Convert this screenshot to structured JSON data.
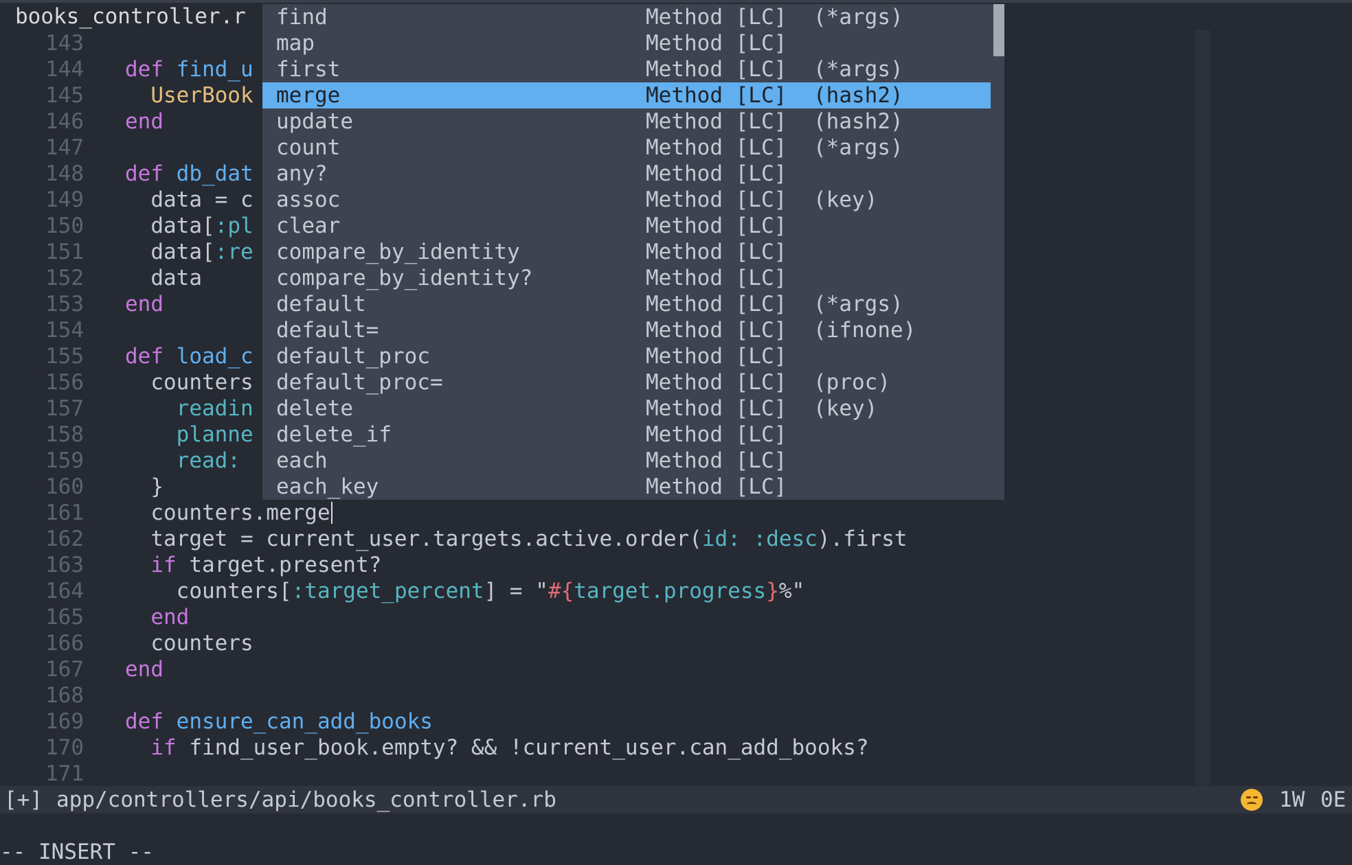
{
  "tab": {
    "title": "books_controller.r"
  },
  "code_lines": [
    {
      "num": "143",
      "tokens": []
    },
    {
      "num": "144",
      "tokens": [
        {
          "t": "keyword",
          "v": "def"
        },
        {
          "t": "text",
          "v": " "
        },
        {
          "t": "function",
          "v": "find_u"
        }
      ]
    },
    {
      "num": "145",
      "tokens": [
        {
          "t": "text",
          "v": "  "
        },
        {
          "t": "constant",
          "v": "UserBook"
        }
      ]
    },
    {
      "num": "146",
      "tokens": [
        {
          "t": "keyword",
          "v": "end"
        }
      ]
    },
    {
      "num": "147",
      "tokens": []
    },
    {
      "num": "148",
      "tokens": [
        {
          "t": "keyword",
          "v": "def"
        },
        {
          "t": "text",
          "v": " "
        },
        {
          "t": "function",
          "v": "db_dat"
        }
      ]
    },
    {
      "num": "149",
      "tokens": [
        {
          "t": "text",
          "v": "  data = c"
        }
      ]
    },
    {
      "num": "150",
      "tokens": [
        {
          "t": "text",
          "v": "  data["
        },
        {
          "t": "symbol",
          "v": ":pl"
        }
      ]
    },
    {
      "num": "151",
      "tokens": [
        {
          "t": "text",
          "v": "  data["
        },
        {
          "t": "symbol",
          "v": ":re"
        }
      ]
    },
    {
      "num": "152",
      "tokens": [
        {
          "t": "text",
          "v": "  data"
        }
      ]
    },
    {
      "num": "153",
      "tokens": [
        {
          "t": "keyword",
          "v": "end"
        }
      ]
    },
    {
      "num": "154",
      "tokens": []
    },
    {
      "num": "155",
      "tokens": [
        {
          "t": "keyword",
          "v": "def"
        },
        {
          "t": "text",
          "v": " "
        },
        {
          "t": "function",
          "v": "load_c"
        }
      ]
    },
    {
      "num": "156",
      "tokens": [
        {
          "t": "text",
          "v": "  counters"
        }
      ]
    },
    {
      "num": "157",
      "tokens": [
        {
          "t": "text",
          "v": "    "
        },
        {
          "t": "symbol",
          "v": "readin"
        }
      ]
    },
    {
      "num": "158",
      "tokens": [
        {
          "t": "text",
          "v": "    "
        },
        {
          "t": "symbol",
          "v": "planne"
        }
      ]
    },
    {
      "num": "159",
      "tokens": [
        {
          "t": "text",
          "v": "    "
        },
        {
          "t": "symbol",
          "v": "read:"
        }
      ]
    },
    {
      "num": "160",
      "tokens": [
        {
          "t": "text",
          "v": "  }"
        }
      ]
    },
    {
      "num": "161",
      "tokens": [
        {
          "t": "text",
          "v": "  counters.merge"
        }
      ],
      "cursor": true
    },
    {
      "num": "162",
      "tokens": [
        {
          "t": "text",
          "v": "  target = current_user.targets.active.order("
        },
        {
          "t": "symbol",
          "v": "id:"
        },
        {
          "t": "text",
          "v": " "
        },
        {
          "t": "symbol",
          "v": ":desc"
        },
        {
          "t": "text",
          "v": ").first"
        }
      ]
    },
    {
      "num": "163",
      "tokens": [
        {
          "t": "text",
          "v": "  "
        },
        {
          "t": "keyword",
          "v": "if"
        },
        {
          "t": "text",
          "v": " target.present?"
        }
      ]
    },
    {
      "num": "164",
      "tokens": [
        {
          "t": "text",
          "v": "    counters["
        },
        {
          "t": "symbol",
          "v": ":target_percent"
        },
        {
          "t": "text",
          "v": "] = \""
        },
        {
          "t": "interp",
          "v": "#{"
        },
        {
          "t": "symbol",
          "v": "target.progress"
        },
        {
          "t": "interp",
          "v": "}"
        },
        {
          "t": "string",
          "v": "%\""
        }
      ]
    },
    {
      "num": "165",
      "tokens": [
        {
          "t": "text",
          "v": "  "
        },
        {
          "t": "keyword",
          "v": "end"
        }
      ]
    },
    {
      "num": "166",
      "tokens": [
        {
          "t": "text",
          "v": "  counters"
        }
      ]
    },
    {
      "num": "167",
      "tokens": [
        {
          "t": "keyword",
          "v": "end"
        }
      ]
    },
    {
      "num": "168",
      "tokens": []
    },
    {
      "num": "169",
      "tokens": [
        {
          "t": "keyword",
          "v": "def"
        },
        {
          "t": "text",
          "v": " "
        },
        {
          "t": "function",
          "v": "ensure_can_add_books"
        }
      ]
    },
    {
      "num": "170",
      "tokens": [
        {
          "t": "text",
          "v": "  "
        },
        {
          "t": "keyword",
          "v": "if"
        },
        {
          "t": "text",
          "v": " find_user_book.empty? && !current_user.can_add_books?"
        }
      ]
    },
    {
      "num": "171",
      "tokens": []
    }
  ],
  "completion": {
    "selected_index": 3,
    "items": [
      {
        "name": "find",
        "kind": "Method [LC]",
        "sig": "(*args)"
      },
      {
        "name": "map",
        "kind": "Method [LC]",
        "sig": ""
      },
      {
        "name": "first",
        "kind": "Method [LC]",
        "sig": "(*args)"
      },
      {
        "name": "merge",
        "kind": "Method [LC]",
        "sig": "(hash2)"
      },
      {
        "name": "update",
        "kind": "Method [LC]",
        "sig": "(hash2)"
      },
      {
        "name": "count",
        "kind": "Method [LC]",
        "sig": "(*args)"
      },
      {
        "name": "any?",
        "kind": "Method [LC]",
        "sig": ""
      },
      {
        "name": "assoc",
        "kind": "Method [LC]",
        "sig": "(key)"
      },
      {
        "name": "clear",
        "kind": "Method [LC]",
        "sig": ""
      },
      {
        "name": "compare_by_identity",
        "kind": "Method [LC]",
        "sig": ""
      },
      {
        "name": "compare_by_identity?",
        "kind": "Method [LC]",
        "sig": ""
      },
      {
        "name": "default",
        "kind": "Method [LC]",
        "sig": "(*args)"
      },
      {
        "name": "default=",
        "kind": "Method [LC]",
        "sig": "(ifnone)"
      },
      {
        "name": "default_proc",
        "kind": "Method [LC]",
        "sig": ""
      },
      {
        "name": "default_proc=",
        "kind": "Method [LC]",
        "sig": "(proc)"
      },
      {
        "name": "delete",
        "kind": "Method [LC]",
        "sig": "(key)"
      },
      {
        "name": "delete_if",
        "kind": "Method [LC]",
        "sig": ""
      },
      {
        "name": "each",
        "kind": "Method [LC]",
        "sig": ""
      },
      {
        "name": "each_key",
        "kind": "Method [LC]",
        "sig": ""
      }
    ]
  },
  "statusline": {
    "modified": "[+]",
    "path": "app/controllers/api/books_controller.rb",
    "lint_icon": "disappointed-face-icon",
    "warnings": "1W",
    "errors": "0E"
  },
  "cmdline": {
    "mode": "-- INSERT --"
  }
}
